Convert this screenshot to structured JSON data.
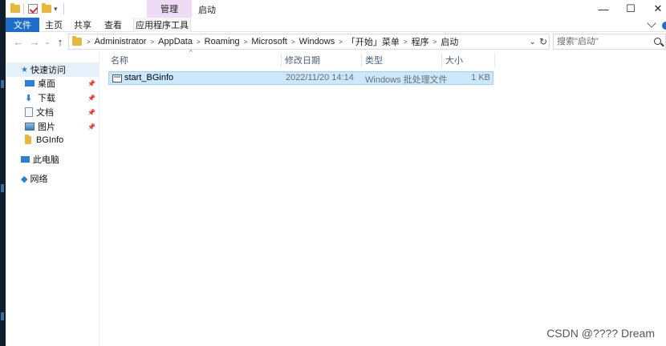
{
  "titlebar": {
    "context_tab": "管理",
    "title": "启动",
    "minimize_glyph": "—",
    "maximize_glyph": "☐",
    "close_glyph": "✕"
  },
  "ribbon": {
    "tabs": [
      "文件",
      "主页",
      "共享",
      "查看",
      "应用程序工具"
    ]
  },
  "address": {
    "crumbs": [
      "Administrator",
      "AppData",
      "Roaming",
      "Microsoft",
      "Windows",
      "「开始」菜单",
      "程序",
      "启动"
    ],
    "search_placeholder": "搜索\"启动\""
  },
  "nav": {
    "quick_access": "快速访问",
    "items": [
      "桌面",
      "下载",
      "文档",
      "图片",
      "BGInfo"
    ],
    "this_pc": "此电脑",
    "network": "网络"
  },
  "columns": {
    "name": "名称",
    "modified": "修改日期",
    "type": "类型",
    "size": "大小"
  },
  "files": [
    {
      "name": "start_BGinfo",
      "modified": "2022/11/20 14:14",
      "type": "Windows 批处理文件",
      "size": "1 KB"
    }
  ],
  "watermark": "CSDN @????  Dream",
  "colors": {
    "file_tab": "#1e6fc9",
    "context_tab": "#eedcf5",
    "selection": "#cce8ff",
    "folder": "#e8b83a"
  }
}
